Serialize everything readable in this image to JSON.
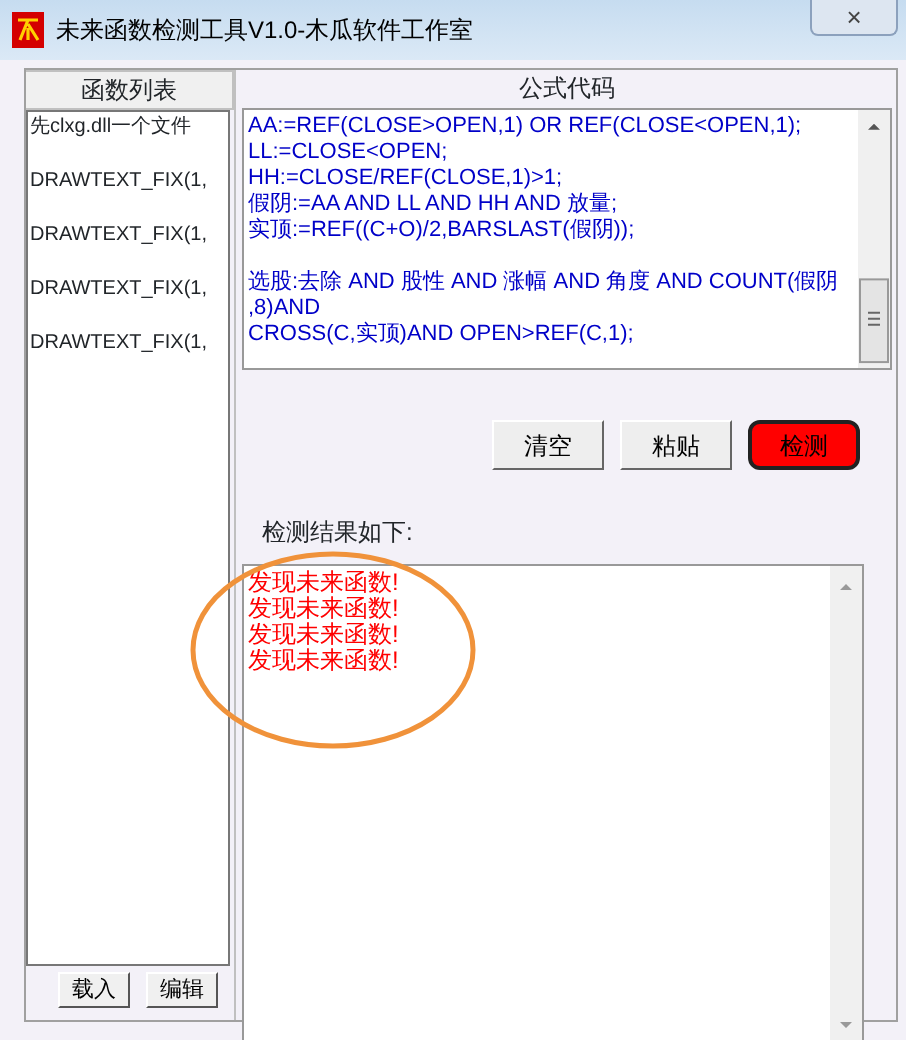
{
  "window": {
    "title": "未来函数检测工具V1.0-木瓜软件工作室",
    "close": "×"
  },
  "function_list": {
    "header": "函数列表",
    "items": [
      {
        "label": "先clxg.dll一个文件",
        "selected": false
      },
      {
        "label": "DRAWTEXT_FIX(1,",
        "selected": false
      },
      {
        "label": "DRAWTEXT_FIX(1,",
        "selected": false
      },
      {
        "label": "DRAWTEXT_FIX(1,",
        "selected": false
      },
      {
        "label": "DRAWTEXT_FIX(1,",
        "selected": false
      }
    ],
    "buttons": [
      "载入",
      "编辑"
    ]
  },
  "formula": {
    "header": "公式代码",
    "blocks": [
      [
        "AA:=REF(CLOSE>OPEN,1) OR REF(CLOSE<OPEN,1);",
        "LL:=CLOSE<OPEN;",
        "HH:=CLOSE/REF(CLOSE,1)>1;",
        "假阴:=AA AND LL AND HH AND 放量;",
        "实顶:=REF((C+O)/2,BARSLAST(假阴));"
      ],
      [
        "选股:去除 AND 股性 AND 涨幅 AND 角度 AND COUNT(假阴",
        ",8)AND",
        "CROSS(C,实顶)AND OPEN>REF(C,1);"
      ]
    ]
  },
  "buttons": [
    {
      "label": "清空",
      "kind": "normal"
    },
    {
      "label": "粘贴",
      "kind": "normal"
    },
    {
      "label": "检测",
      "kind": "alert"
    }
  ],
  "result": {
    "label": "检测结果如下:",
    "lines": [
      "发现未来函数!",
      "发现未来函数!",
      "发现未来函数!",
      "发现未来函数!"
    ]
  },
  "annotation": {
    "kind": "ellipse",
    "color": "#f0923a"
  }
}
